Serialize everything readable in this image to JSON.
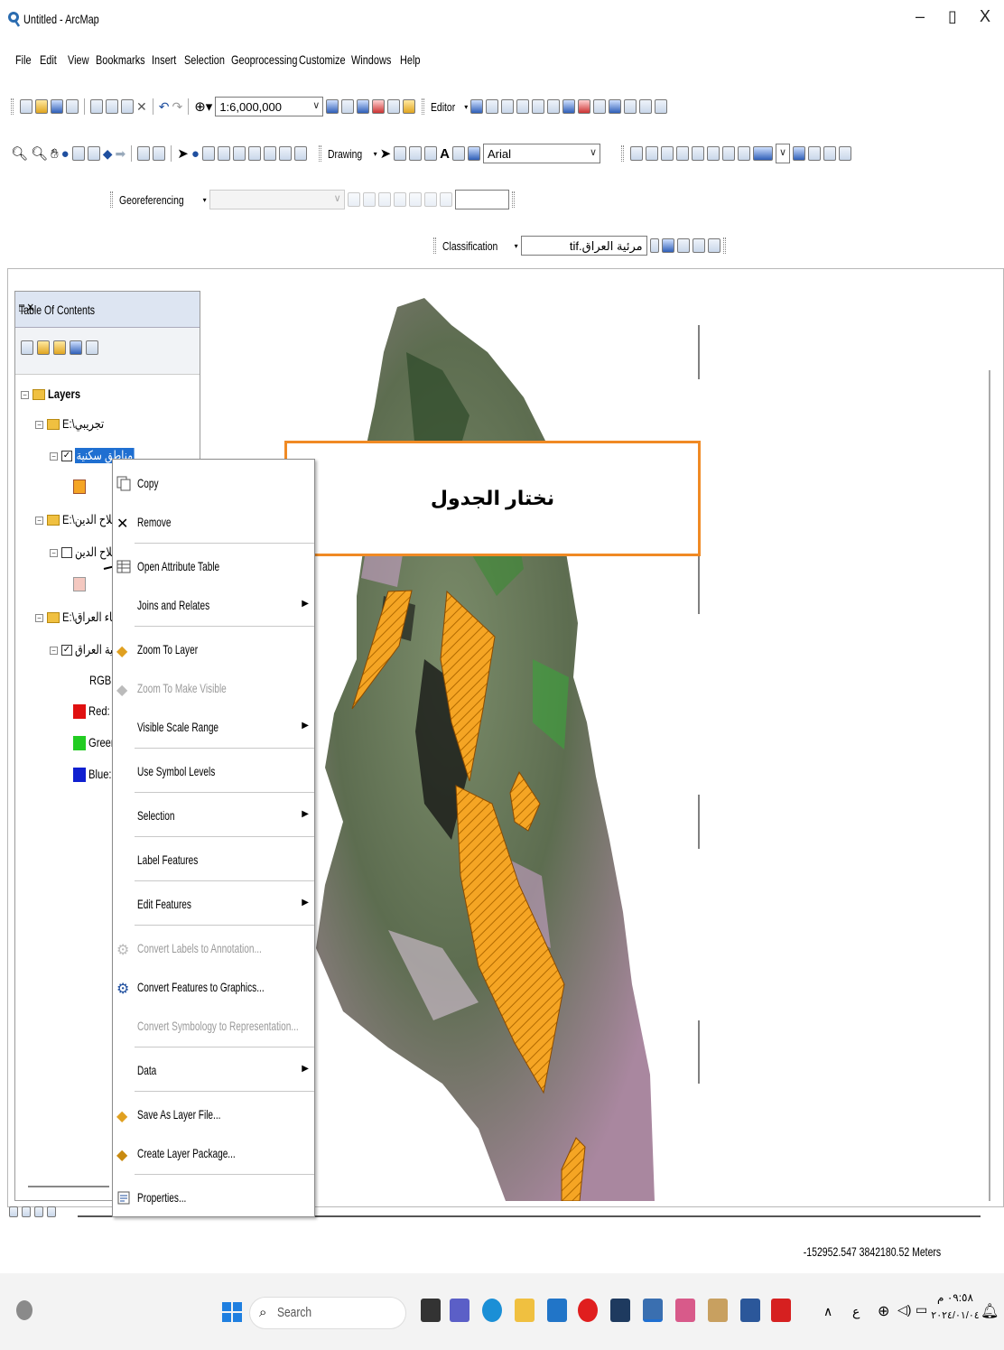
{
  "window": {
    "title": "Untitled - ArcMap",
    "minimize": "–",
    "restore": "▯",
    "close": "X"
  },
  "menu": [
    "File",
    "Edit",
    "View",
    "Bookmarks",
    "Insert",
    "Selection",
    "Geoprocessing",
    "Customize",
    "Windows",
    "Help"
  ],
  "toolbars": {
    "scale": "1:6,000,000",
    "editor_label": "Editor",
    "drawing_label": "Drawing",
    "font_name": "Arial",
    "georeferencing_label": "Georeferencing",
    "classification_label": "Classification",
    "classification_layer": "مرئية العراق.tif"
  },
  "toc": {
    "title": "Table Of Contents",
    "root": "Layers",
    "groups": [
      {
        "folder": "E:\\تجريبي",
        "layer": "مناطق سكنية",
        "checked": true,
        "selected": true
      },
      {
        "folder": "E:\\صلاح الدين",
        "layer": "صلاح الدين",
        "checked": false
      },
      {
        "folder": "E:\\انحاء العراق",
        "layer": "مرئية العراق",
        "checked": true
      }
    ],
    "raster": {
      "type_label": "RGB",
      "bands": [
        "Red:",
        "Green:",
        "Blue:"
      ]
    }
  },
  "context_menu": [
    {
      "label": "Copy",
      "icon": "copy-icon",
      "enabled": true,
      "submenu": false
    },
    {
      "label": "Remove",
      "icon": "remove-icon",
      "enabled": true,
      "submenu": false
    },
    {
      "label": "Open Attribute Table",
      "icon": "table-icon",
      "enabled": true,
      "submenu": false
    },
    {
      "label": "Joins and Relates",
      "icon": "",
      "enabled": true,
      "submenu": true
    },
    {
      "label": "Zoom To Layer",
      "icon": "zoom-layer-icon",
      "enabled": true,
      "submenu": false
    },
    {
      "label": "Zoom To Make Visible",
      "icon": "zoom-visible-icon",
      "enabled": false,
      "submenu": false
    },
    {
      "label": "Visible Scale Range",
      "icon": "",
      "enabled": true,
      "submenu": true
    },
    {
      "label": "Use Symbol Levels",
      "icon": "",
      "enabled": true,
      "submenu": false
    },
    {
      "label": "Selection",
      "icon": "",
      "enabled": true,
      "submenu": true
    },
    {
      "label": "Label Features",
      "icon": "",
      "enabled": true,
      "submenu": false
    },
    {
      "label": "Edit Features",
      "icon": "",
      "enabled": true,
      "submenu": true
    },
    {
      "label": "Convert Labels to Annotation...",
      "icon": "convert-labels-icon",
      "enabled": false,
      "submenu": false
    },
    {
      "label": "Convert Features to Graphics...",
      "icon": "convert-features-icon",
      "enabled": true,
      "submenu": false
    },
    {
      "label": "Convert Symbology to Representation...",
      "icon": "",
      "enabled": false,
      "submenu": false
    },
    {
      "label": "Data",
      "icon": "",
      "enabled": true,
      "submenu": true
    },
    {
      "label": "Save As Layer File...",
      "icon": "layer-file-icon",
      "enabled": true,
      "submenu": false
    },
    {
      "label": "Create Layer Package...",
      "icon": "layer-package-icon",
      "enabled": true,
      "submenu": false
    },
    {
      "label": "Properties...",
      "icon": "properties-icon",
      "enabled": true,
      "submenu": false
    }
  ],
  "callout": {
    "text": "نختار الجدول"
  },
  "status": {
    "coordinates": "-152952.547  3842180.52 Meters"
  },
  "taskbar": {
    "search": "Search",
    "time": "٠٩:٥٨ م",
    "date": "٢٠٢٤/٠١/٠٤",
    "lang": "ع"
  }
}
